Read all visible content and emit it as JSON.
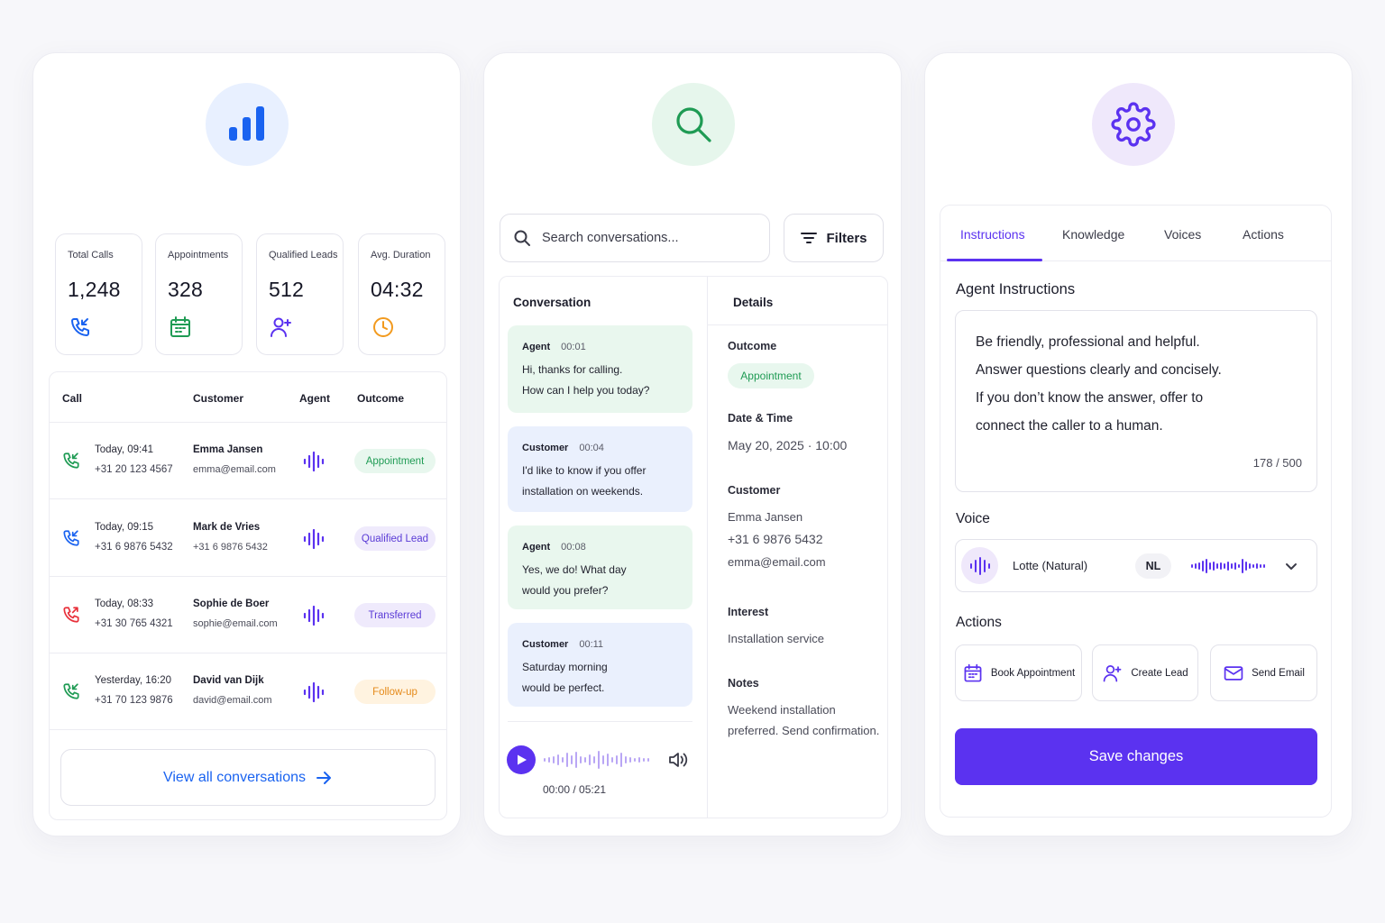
{
  "colors": {
    "blue": "#1a63f0",
    "green": "#1f9b54",
    "red": "#e8303a",
    "purple": "#5b32f0",
    "orange": "#f29a1e"
  },
  "analytics": {
    "icon": "bar-chart-icon",
    "stats": [
      {
        "label": "Total Calls",
        "value": "1,248",
        "icon": "phone-incoming-icon"
      },
      {
        "label": "Appointments",
        "value": "328",
        "icon": "calendar-icon"
      },
      {
        "label": "Qualified Leads",
        "value": "512",
        "icon": "user-plus-icon"
      },
      {
        "label": "Avg. Duration",
        "value": "04:32",
        "icon": "clock-icon"
      }
    ],
    "table": {
      "headers": {
        "call": "Call",
        "customer": "Customer",
        "agent": "Agent",
        "outcome": "Outcome"
      },
      "rows": [
        {
          "time": "Today, 09:41",
          "phone": "+31 20 123 4567",
          "name": "Emma Jansen",
          "email": "emma@email.com",
          "outcome": "Appointment",
          "status": "incoming-green"
        },
        {
          "time": "Today, 09:15",
          "phone": "+31 6 9876 5432",
          "name": "Mark de Vries",
          "email": "+31 6 9876 5432",
          "outcome": "Qualified Lead",
          "status": "incoming-blue"
        },
        {
          "time": "Today, 08:33",
          "phone": "+31 30 765 4321",
          "name": "Sophie de Boer",
          "email": "sophie@email.com",
          "outcome": "Transferred",
          "status": "outgoing-red"
        },
        {
          "time": "Yesterday, 16:20",
          "phone": "+31 70 123 9876",
          "name": "David van Dijk",
          "email": "david@email.com",
          "outcome": "Follow-up",
          "status": "incoming-green"
        }
      ]
    },
    "view_all": "View all conversations"
  },
  "conversations": {
    "icon": "search-icon",
    "search_placeholder": "Search conversations...",
    "filters_label": "Filters",
    "conversation_header": "Conversation",
    "messages": [
      {
        "who": "Agent",
        "time": "00:01",
        "lines": [
          "Hi, thanks for calling.",
          "How can I help you today?"
        ]
      },
      {
        "who": "Customer",
        "time": "00:04",
        "lines": [
          "I'd like to know if you offer",
          "installation on weekends."
        ]
      },
      {
        "who": "Agent",
        "time": "00:08",
        "lines": [
          "Yes, we do! What day",
          "would you prefer?"
        ]
      },
      {
        "who": "Customer",
        "time": "00:11",
        "lines": [
          "Saturday morning",
          "would be perfect."
        ]
      }
    ],
    "audio_time": "00:00 / 05:21",
    "details": {
      "header": "Details",
      "outcome_label": "Outcome",
      "outcome": "Appointment",
      "datetime_label": "Date & Time",
      "datetime": "May 20, 2025 · 10:00",
      "customer_label": "Customer",
      "customer_name": "Emma Jansen",
      "customer_phone": "+31 6 9876 5432",
      "customer_email": "emma@email.com",
      "interest_label": "Interest",
      "interest": "Installation service",
      "notes_label": "Notes",
      "notes_1": "Weekend installation",
      "notes_2": "preferred. Send confirmation."
    }
  },
  "settings": {
    "icon": "gear-icon",
    "tabs": [
      "Instructions",
      "Knowledge",
      "Voices",
      "Actions"
    ],
    "active_tab": "Instructions",
    "instructions_title": "Agent Instructions",
    "instructions": [
      "Be friendly, professional and helpful.",
      "Answer questions clearly and concisely.",
      "If you don’t know the answer, offer to",
      "connect the caller to a human."
    ],
    "char_count": "178 / 500",
    "voice_title": "Voice",
    "voice_name": "Lotte (Natural)",
    "voice_lang": "NL",
    "actions_title": "Actions",
    "actions": [
      {
        "label": "Book Appointment",
        "icon": "calendar-icon"
      },
      {
        "label": "Create Lead",
        "icon": "user-plus-icon"
      },
      {
        "label": "Send Email",
        "icon": "mail-icon"
      }
    ],
    "save_label": "Save changes"
  }
}
